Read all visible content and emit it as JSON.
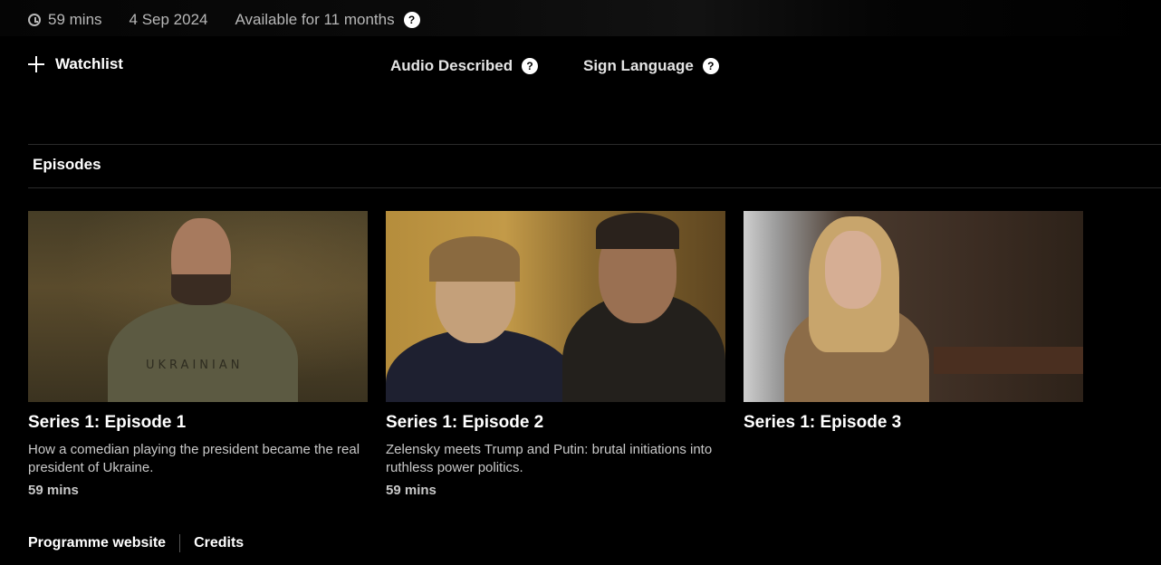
{
  "meta": {
    "duration": "59 mins",
    "date": "4 Sep 2024",
    "availability": "Available for 11 months"
  },
  "actions": {
    "watchlist": "Watchlist",
    "audio_described": "Audio Described",
    "sign_language": "Sign Language",
    "help_glyph": "?"
  },
  "episodes": {
    "heading": "Episodes",
    "items": [
      {
        "title": "Series 1: Episode 1",
        "description": "How a comedian playing the president became the real president of Ukraine.",
        "duration": "59 mins",
        "shirt_text": "UKRAINIAN"
      },
      {
        "title": "Series 1: Episode 2",
        "description": "Zelensky meets Trump and Putin: brutal initiations into ruthless power politics.",
        "duration": "59 mins"
      },
      {
        "title": "Series 1: Episode 3",
        "description": "",
        "duration": ""
      }
    ]
  },
  "footer": {
    "programme_website": "Programme website",
    "credits": "Credits"
  },
  "colors": {
    "background": "#000000",
    "text": "#ffffff",
    "muted_text": "#b8b8b8",
    "divider": "#2a2a2a"
  },
  "icons": [
    "clock-icon",
    "help-icon",
    "plus-icon"
  ]
}
